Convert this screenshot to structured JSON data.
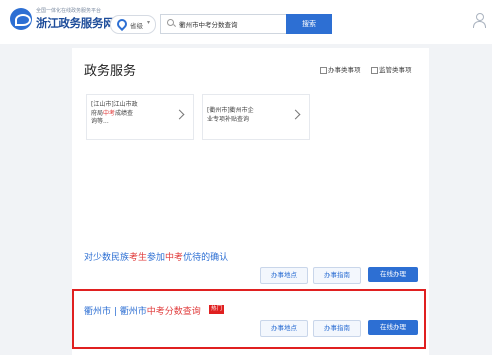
{
  "header": {
    "logo_tagline": "全国一体化在线政务服务平台",
    "logo_title": "浙江政务服务网",
    "region": "省级",
    "search_value": "衢州市中考分数查询",
    "search_button": "搜索"
  },
  "panel": {
    "title": "政务服务",
    "filters": [
      "办事类事项",
      "监管类事项"
    ],
    "cards": [
      {
        "line1": "[江山市]江山市政",
        "line2_pre": "府局",
        "line2_red": "中考",
        "line2_post": "成绩查",
        "line3": "询等..."
      },
      {
        "line1": "[衢州市]衢州市企",
        "line2_pre": "业专项补贴查询",
        "line2_red": "",
        "line2_post": "",
        "line3": ""
      }
    ],
    "results": [
      {
        "title_pre": "对少数民族",
        "title_red1": "考生",
        "title_mid": "参加",
        "title_red2": "中考",
        "title_post": "优待的确认",
        "buttons": [
          "办事地点",
          "办事指南",
          "在线办理"
        ]
      },
      {
        "title_pre": "衢州市 | 衢州市",
        "title_red": "中考分数查询",
        "badge": "热门",
        "buttons": [
          "办事地点",
          "办事指南",
          "在线办理"
        ]
      }
    ]
  },
  "colors": {
    "primary": "#2d6fd3",
    "highlight_border": "#e02020",
    "keyword": "#e03b3b"
  }
}
